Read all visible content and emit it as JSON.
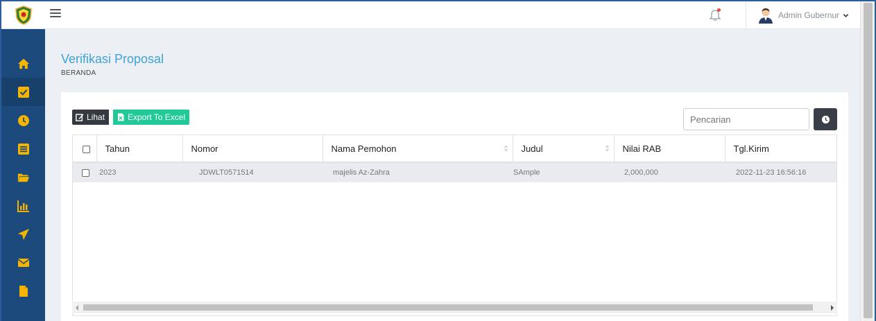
{
  "topbar": {
    "user_name": "Admin Gubernur"
  },
  "page": {
    "title": "Verifikasi Proposal",
    "breadcrumb": "BERANDA"
  },
  "toolbar": {
    "lihat_label": "Lihat",
    "export_label": "Export To Excel"
  },
  "search": {
    "placeholder": "Pencarian"
  },
  "table": {
    "columns": [
      "Tahun",
      "Nomor",
      "Nama Pemohon",
      "Judul",
      "Nilai RAB",
      "Tgl.Kirim"
    ],
    "rows": [
      {
        "tahun": "2023",
        "nomor": "JDWLT0571514",
        "nama_pemohon": "majelis Az-Zahra",
        "judul": "SAmple",
        "nilai_rab": "2,000,000",
        "tgl_kirim": "2022-11-23 16:56:16"
      }
    ]
  },
  "colors": {
    "sidebar": "#1c4a7d",
    "accent_title": "#3fa3d7",
    "excel_button": "#20c997",
    "dark_button": "#343a40"
  },
  "icons": {
    "sidebar": [
      "home-icon",
      "check-square-icon",
      "clock-icon",
      "list-icon",
      "folder-open-icon",
      "bar-chart-icon",
      "paper-plane-icon",
      "envelope-icon",
      "file-icon"
    ]
  }
}
